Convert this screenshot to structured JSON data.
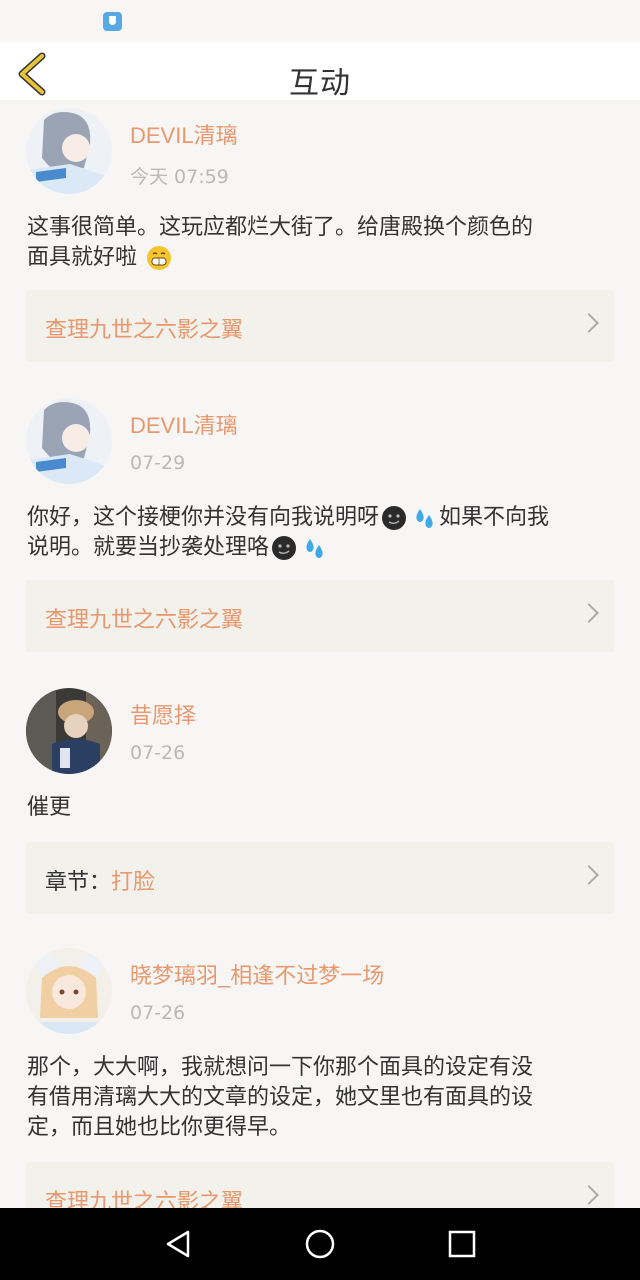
{
  "header": {
    "title": "互动"
  },
  "posts": [
    {
      "username": "DEVIL清璃",
      "date": "今天 07:59",
      "text_line1": "这事很简单。这玩应都烂大街了。给唐殿换个颜色的",
      "text_line2": "面具就好啦",
      "card": {
        "label": "",
        "link": "查理九世之六影之翼"
      }
    },
    {
      "username": "DEVIL清璃",
      "date": "07-29",
      "text_line1a": "你好，这个接梗你并没有向我说明呀",
      "text_line1b": "如果不向我",
      "text_line2": "说明。就要当抄袭处理咯",
      "card": {
        "label": "",
        "link": "查理九世之六影之翼"
      }
    },
    {
      "username": "昔愿择",
      "date": "07-26",
      "text_line1": "催更",
      "card": {
        "label": "章节：",
        "link": "打脸"
      }
    },
    {
      "username": "晓梦璃羽_相逢不过梦一场",
      "date": "07-26",
      "text_line1": "那个，大大啊，我就想问一下你那个面具的设定有没",
      "text_line2": "有借用清璃大大的文章的设定，她文里也有面具的设",
      "text_line3": "定，而且她也比你更得早。",
      "card": {
        "label": "",
        "link": "查理九世之六影之翼"
      }
    }
  ],
  "icons": {
    "back": "chevron-left-icon",
    "grin": "grin-emoji-icon",
    "smirk": "smirk-emoji-icon",
    "sweat": "sweat-drops-emoji-icon",
    "nav_back": "triangle-back-icon",
    "nav_home": "circle-home-icon",
    "nav_recent": "square-recent-icon"
  },
  "colors": {
    "accent": "#e8986e",
    "back_icon": "#e8c33a",
    "card_bg": "#f2f1ec"
  }
}
